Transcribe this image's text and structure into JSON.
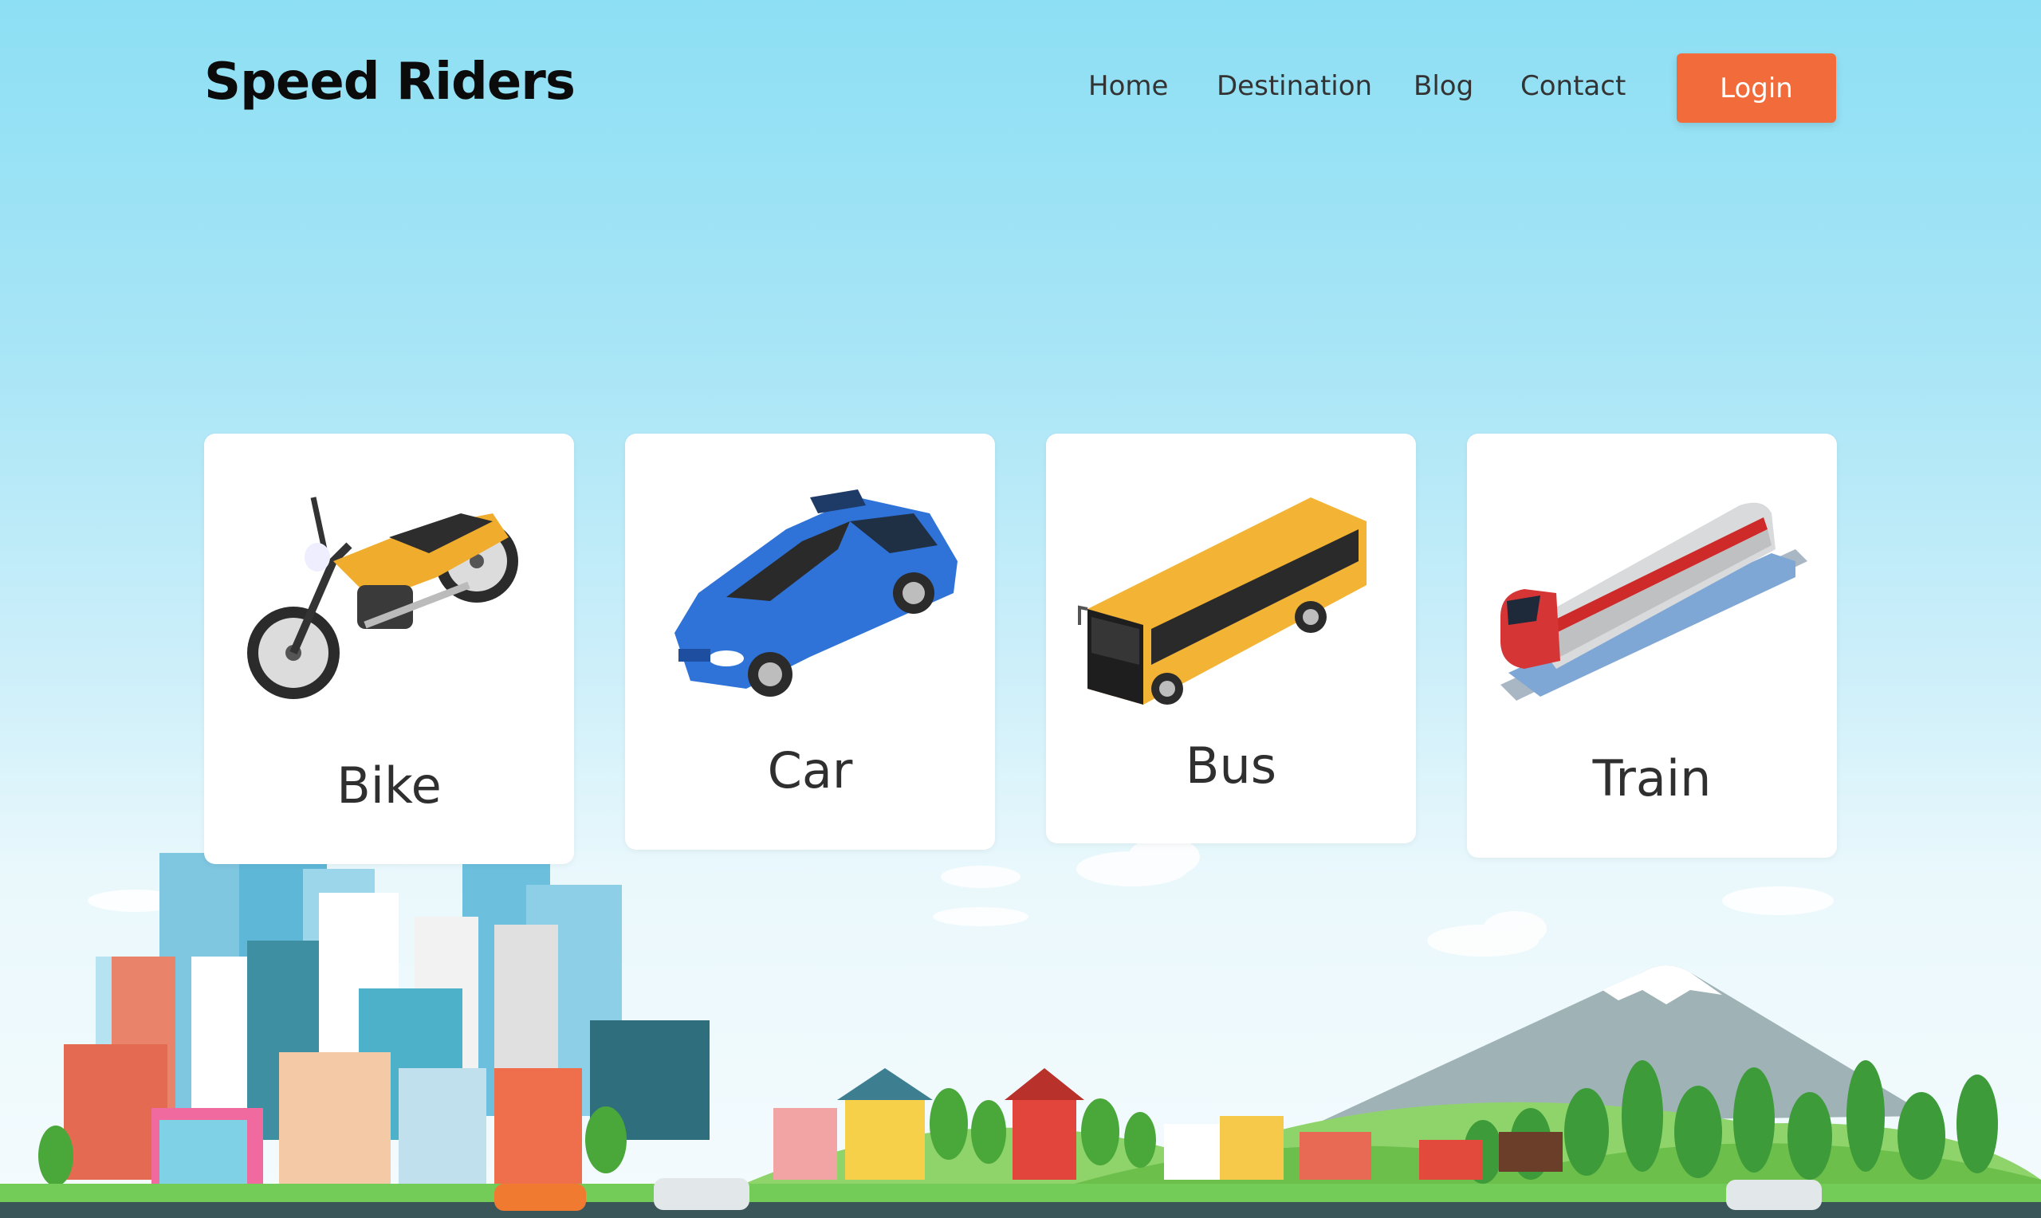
{
  "header": {
    "brand": "Speed Riders",
    "nav": [
      {
        "label": "Home"
      },
      {
        "label": "Destination"
      },
      {
        "label": "Blog"
      },
      {
        "label": "Contact"
      }
    ],
    "login_label": "Login"
  },
  "cards": [
    {
      "label": "Bike",
      "icon": "motorcycle-icon"
    },
    {
      "label": "Car",
      "icon": "car-icon"
    },
    {
      "label": "Bus",
      "icon": "bus-icon"
    },
    {
      "label": "Train",
      "icon": "train-icon"
    }
  ],
  "colors": {
    "accent": "#f26b3a",
    "sky_top": "#8ddff4",
    "text_dark": "#0b0b0b",
    "card_bg": "#ffffff"
  }
}
